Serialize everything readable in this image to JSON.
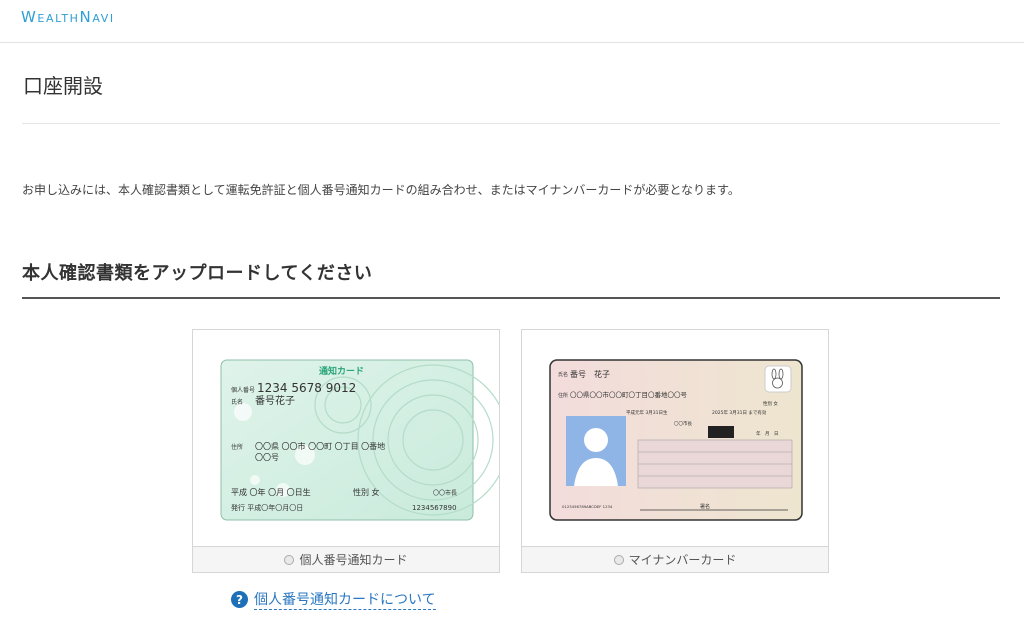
{
  "header": {
    "logo": "WealthNavi"
  },
  "page": {
    "title": "口座開設",
    "notice": "お申し込みには、本人確認書類として運転免許証と個人番号通知カードの組み合わせ、またはマイナンバーカードが必要となります。",
    "section_title": "本人確認書類をアップロードしてください"
  },
  "options": [
    {
      "label": "個人番号通知カード",
      "selected": false,
      "card": {
        "heading": "通知カード",
        "number_label": "個人番号",
        "number": "1234 5678 9012",
        "name_label": "氏名",
        "name": "番号花子",
        "address_label": "住所",
        "address_line1": "〇〇県 〇〇市 〇〇町 〇丁目 〇番地",
        "address_line2": "〇〇号",
        "birth": "平成 〇年 〇月 〇日生",
        "gender": "性別 女",
        "issuer": "〇〇市長",
        "issued": "発行 平成〇年〇月〇日",
        "serial": "1234567890"
      }
    },
    {
      "label": "マイナンバーカード",
      "selected": false,
      "card": {
        "name_label": "氏名",
        "name": "番号　花子",
        "address_label": "住所",
        "address": "〇〇県〇〇市〇〇町〇丁目〇番地〇〇号",
        "gender": "性別 女",
        "birth": "平成元年 3月31日生",
        "expiry": "2025年 3月31日 まで有効",
        "issuer": "〇〇市長",
        "date_labels": "年　月　日",
        "code": "0123456789ABCDEF 1234",
        "signature_label": "署名"
      }
    }
  ],
  "help": {
    "link_text": "個人番号通知カードについて",
    "icon": "?"
  },
  "colors": {
    "brand": "#2ea0d6",
    "link": "#2b78c2",
    "notice_card": "#d4efe3",
    "mynumber_card": "#f3e3da"
  }
}
